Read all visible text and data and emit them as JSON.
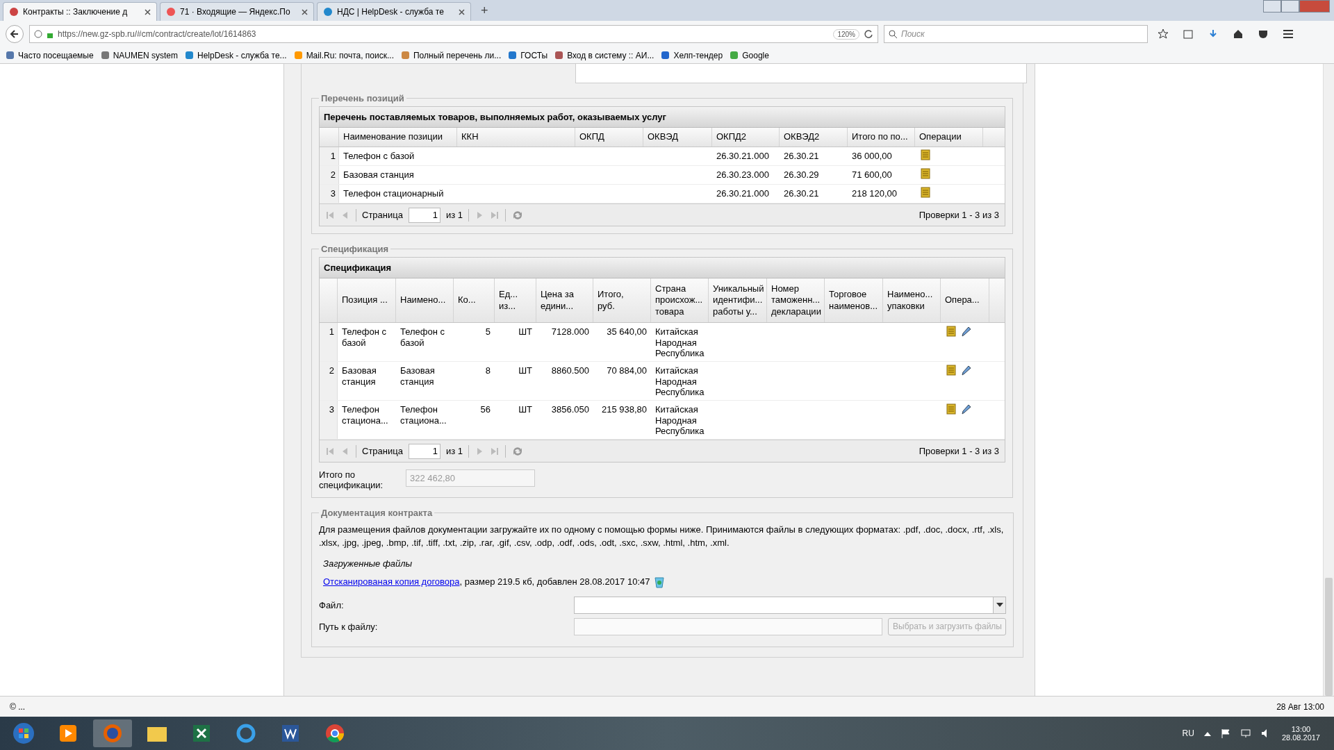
{
  "browser": {
    "tabs": [
      {
        "title": "Контракты :: Заключение д",
        "selected": true
      },
      {
        "title": "71 · Входящие — Яндекс.По",
        "selected": false
      },
      {
        "title": "НДС | HelpDesk - служба те",
        "selected": false
      }
    ],
    "new_tab": "+",
    "url": "https://new.gz-spb.ru/#cm/contract/create/lot/1614863",
    "zoom": "120%",
    "search": {
      "placeholder": "Поиск"
    },
    "bookmarks": [
      "Часто посещаемые",
      "NAUMEN system",
      "HelpDesk - служба те...",
      "Mail.Ru: почта, поиск...",
      "Полный перечень ли...",
      "ГОСТы",
      "Вход в систему :: АИ...",
      "Хелп-тендер",
      "Google"
    ]
  },
  "positions": {
    "legend": "Перечень позиций",
    "title": "Перечень поставляемых товаров, выполняемых работ, оказываемых услуг",
    "columns": [
      "Наименование позиции",
      "ККН",
      "ОКПД",
      "ОКВЭД",
      "ОКПД2",
      "ОКВЭД2",
      "Итого по по...",
      "Операции"
    ],
    "rows": [
      {
        "num": "1",
        "cells": [
          "Телефон с базой",
          "",
          "",
          "",
          "26.30.21.000",
          "26.30.21",
          "36 000,00"
        ]
      },
      {
        "num": "2",
        "cells": [
          "Базовая станция",
          "",
          "",
          "",
          "26.30.23.000",
          "26.30.29",
          "71 600,00"
        ]
      },
      {
        "num": "3",
        "cells": [
          "Телефон стационарный",
          "",
          "",
          "",
          "26.30.21.000",
          "26.30.21",
          "218 120,00"
        ]
      }
    ],
    "pager": {
      "page_label": "Страница",
      "page": "1",
      "of": "из 1",
      "summary": "Проверки 1 - 3 из 3"
    }
  },
  "specification": {
    "legend": "Спецификация",
    "title": "Спецификация",
    "columns": [
      "Позиция ...",
      "Наимено...",
      "Ко...",
      "Ед...\nиз...",
      "Цена за\nедини...",
      "Итого,\nруб.",
      "Страна\nпроисхож...\nтовара",
      "Уникальный\nидентифи...\nработы у...",
      "Номер\nтаможенн...\nдекларации",
      "Торговое\nнаименов...",
      "Наимено...\nупаковки",
      "Опера..."
    ],
    "rows": [
      {
        "num": "1",
        "cells": [
          "Телефон с базой",
          "Телефон с базой",
          "5",
          "ШТ",
          "7128.000",
          "35 640,00",
          "Китайская Народная Республика",
          "",
          "",
          "",
          ""
        ]
      },
      {
        "num": "2",
        "cells": [
          "Базовая станция",
          "Базовая станция",
          "8",
          "ШТ",
          "8860.500",
          "70 884,00",
          "Китайская Народная Республика",
          "",
          "",
          "",
          ""
        ]
      },
      {
        "num": "3",
        "cells": [
          "Телефон стациона...",
          "Телефон стациона...",
          "56",
          "ШТ",
          "3856.050",
          "215 938,80",
          "Китайская Народная Республика",
          "",
          "",
          "",
          ""
        ]
      }
    ],
    "pager": {
      "page_label": "Страница",
      "page": "1",
      "of": "из 1",
      "summary": "Проверки 1 - 3 из 3"
    },
    "total_label": "Итого по спецификации:",
    "total_value": "322 462,80"
  },
  "documents": {
    "legend": "Документация контракта",
    "info": "Для размещения файлов документации загружайте их по одному с помощью формы ниже. Принимаются файлы в следующих форматах: .pdf, .doc, .docx, .rtf, .xls, .xlsx, .jpg, .jpeg, .bmp, .tif, .tiff, .txt, .zip, .rar, .gif, .csv, .odp, .odf, .ods, .odt, .sxc, .sxw, .html, .htm, .xml.",
    "uploaded_label": "Загруженные файлы",
    "file_link": "Отсканированая копия договора",
    "file_meta": ", размер 219.5 кб, добавлен 28.08.2017 10:47",
    "file_label": "Файл:",
    "path_label": "Путь к файлу:",
    "upload_button": {
      "label": "Выбрать и загрузить файлы",
      "disabled": true
    }
  },
  "status_bar": {
    "left": "© ...",
    "right": "28 Авг 13:00"
  },
  "taskbar": {
    "language": "RU",
    "time": "13:00",
    "date": "28.08.2017"
  }
}
